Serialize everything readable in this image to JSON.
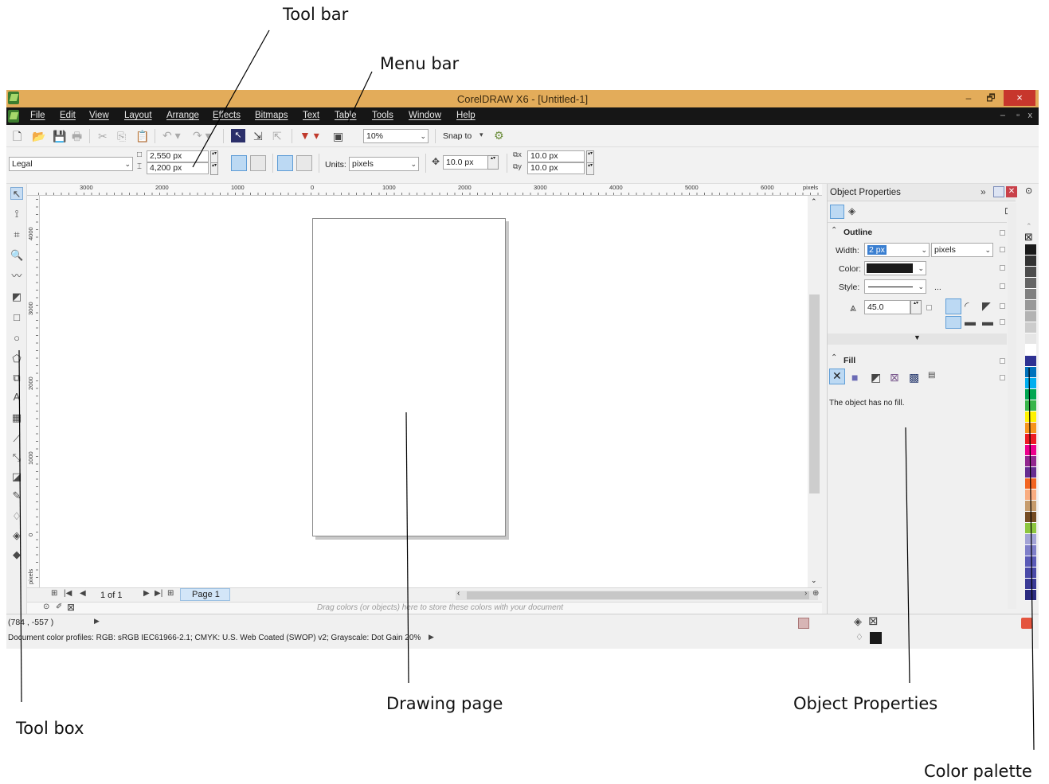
{
  "annotations": {
    "toolbar": "Tool bar",
    "menubar": "Menu bar",
    "drawing_page": "Drawing page",
    "object_properties": "Object Properties",
    "toolbox": "Tool box",
    "color_palette": "Color palette"
  },
  "window": {
    "title": "CorelDRAW X6 - [Untitled-1]",
    "minimize": "–",
    "restore": "🗗",
    "close": "×"
  },
  "menu": {
    "items": [
      "File",
      "Edit",
      "View",
      "Layout",
      "Arrange",
      "Effects",
      "Bitmaps",
      "Text",
      "Table",
      "Tools",
      "Window",
      "Help"
    ],
    "doc_min": "–",
    "doc_restore": "▫",
    "doc_close": "x"
  },
  "standard_toolbar": {
    "zoom": "10%",
    "snap_to": "Snap to"
  },
  "property_bar": {
    "page_size": "Legal",
    "width": "2,550 px",
    "height": "4,200 px",
    "units_label": "Units:",
    "units": "pixels",
    "nudge": "10.0 px",
    "dup_x": "10.0 px",
    "dup_y": "10.0 px"
  },
  "rulers": {
    "horizontal": [
      "3000",
      "2000",
      "1000",
      "0",
      "1000",
      "2000",
      "3000",
      "4000",
      "5000",
      "6000"
    ],
    "units": "pixels",
    "vertical": [
      "4000",
      "3000",
      "2000",
      "1000",
      "0"
    ],
    "vertical_units": "pixels"
  },
  "page_nav": {
    "counter": "1 of 1",
    "tab": "Page 1"
  },
  "document_palette": {
    "hint": "Drag colors (or objects) here to store these colors with your document"
  },
  "docker": {
    "title": "Object Properties",
    "outline": {
      "title": "Outline",
      "width_label": "Width:",
      "width": "2 px",
      "width_units": "pixels",
      "color_label": "Color:",
      "style_label": "Style:",
      "more": "...",
      "miter": "45.0"
    },
    "fill": {
      "title": "Fill",
      "message": "The object has no fill."
    }
  },
  "palette": {
    "colors": [
      "#1a1a1a",
      "#333333",
      "#4d4d4d",
      "#666666",
      "#808080",
      "#999999",
      "#b3b3b3",
      "#cccccc",
      "#e6e6e6",
      "#ffffff",
      "#2e3192",
      "#0072bc",
      "#00aeef",
      "#00a651",
      "#39b54a",
      "#fff200",
      "#f7941d",
      "#ed1c24",
      "#ec008c",
      "#92278f",
      "#662d91",
      "#f26522",
      "#f9ad81",
      "#c69c6d",
      "#754c24",
      "#8dc63f",
      "#a3a3d6",
      "#7f7fc9",
      "#5b5bb7",
      "#4a4aa8",
      "#3a3a96",
      "#2b2b80"
    ]
  },
  "status": {
    "coords": "(784 , -557 )",
    "profiles": "Document color profiles: RGB: sRGB IEC61966-2.1; CMYK: U.S. Web Coated (SWOP) v2; Grayscale: Dot Gain 20%"
  }
}
